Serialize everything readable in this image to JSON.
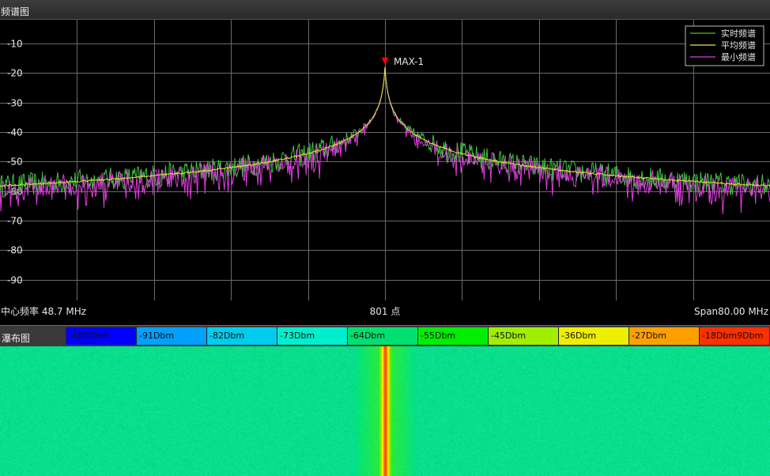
{
  "panels": {
    "spectrum_title": "频谱图",
    "waterfall_title": "瀑布图"
  },
  "spectrum_info": {
    "center_freq": "中心频率  48.7 MHz",
    "points": "801 点",
    "span": "Span80.00 MHz"
  },
  "marker": {
    "label": "MAX-1",
    "color": "#ff0000"
  },
  "colorbar": {
    "labels": [
      "-100Dbm",
      "-91Dbm",
      "-82Dbm",
      "-73Dbm",
      "-64Dbm",
      "-55Dbm",
      "-45Dbm",
      "-36Dbm",
      "-27Dbm",
      "-18Dbm9Dbm"
    ],
    "colors": [
      "#0000ff",
      "#00a0ff",
      "#00ccee",
      "#00eecc",
      "#00e070",
      "#00ee00",
      "#a0ee00",
      "#eeee00",
      "#ffa000",
      "#ff3000"
    ]
  },
  "chart_data": {
    "type": "line",
    "xlim": [
      0,
      800
    ],
    "ylim": [
      -97,
      -2
    ],
    "yticks": [
      -10,
      -20,
      -30,
      -40,
      -50,
      -60,
      -70,
      -80,
      -90
    ],
    "ytick_labels": [
      "-10",
      "-20",
      "-30",
      "-40",
      "-50",
      "-60",
      "-70",
      "-80",
      "-90"
    ],
    "grid": true,
    "legend_position": "top-right",
    "peak_x": 400,
    "peak_y": -18,
    "series": [
      {
        "name": "实时频谱",
        "color": "#3ec43e",
        "noise_floor": -72,
        "noise_amp": 4
      },
      {
        "name": "平均频谱",
        "color": "#e6e63c",
        "noise_floor": -72.5,
        "noise_amp": 0.3
      },
      {
        "name": "最小频谱",
        "color": "#e03ce0",
        "noise_floor": -82,
        "noise_amp": 3
      }
    ]
  }
}
